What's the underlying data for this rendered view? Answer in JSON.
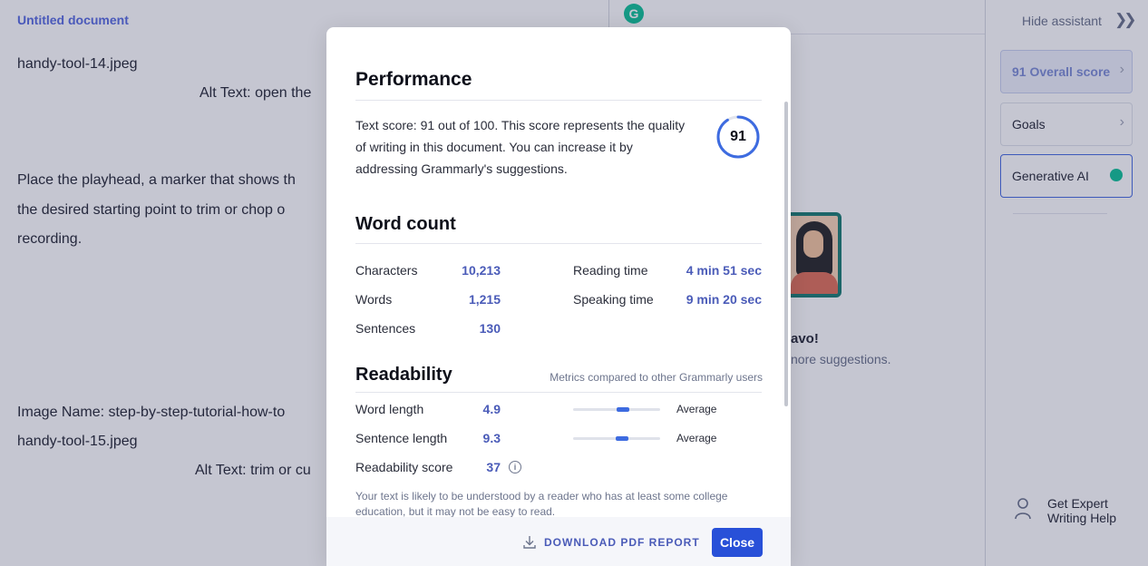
{
  "document": {
    "title": "Untitled document",
    "lines": [
      "handy-tool-14.jpeg",
      "Alt Text: open the",
      "Place the playhead, a marker that shows th",
      "the desired starting point to trim or chop o",
      "recording.",
      "Image Name: step-by-step-tutorial-how-to",
      "handy-tool-15.jpeg",
      "Alt Text: trim or cu"
    ]
  },
  "assistant": {
    "logo_letter": "G",
    "bravo_title": "avo!",
    "bravo_sub": "nore suggestions."
  },
  "sidebar": {
    "hide_label": "Hide assistant",
    "hide_chevrons": "❯❯",
    "overall_score_label": "91 Overall score",
    "goals_label": "Goals",
    "generative_ai_label": "Generative AI",
    "expert_help_line1": "Get Expert",
    "expert_help_line2": "Writing Help"
  },
  "modal": {
    "performance": {
      "heading": "Performance",
      "text": "Text score: 91 out of 100. This score represents the quality of writing in this document. You can increase it by addressing Grammarly's suggestions.",
      "score": "91",
      "score_fraction": 0.91
    },
    "word_count": {
      "heading": "Word count",
      "characters_label": "Characters",
      "characters_value": "10,213",
      "words_label": "Words",
      "words_value": "1,215",
      "sentences_label": "Sentences",
      "sentences_value": "130",
      "reading_time_label": "Reading time",
      "reading_time_value": "4 min 51 sec",
      "speaking_time_label": "Speaking time",
      "speaking_time_value": "9 min 20 sec"
    },
    "readability": {
      "heading": "Readability",
      "note": "Metrics compared to other Grammarly users",
      "word_length_label": "Word length",
      "word_length_value": "4.9",
      "word_length_position": 0.57,
      "word_length_rating": "Average",
      "sentence_length_label": "Sentence length",
      "sentence_length_value": "9.3",
      "sentence_length_position": 0.56,
      "sentence_length_rating": "Average",
      "score_label": "Readability score",
      "score_value": "37",
      "info_glyph": "i",
      "description": "Your text is likely to be understood by a reader who has at least some college education, but it may not be easy to read."
    },
    "footer": {
      "download_label": "DOWNLOAD PDF REPORT",
      "close_label": "Close"
    }
  },
  "colors": {
    "accent": "#2850d8",
    "value_text": "#4a5bb8",
    "grammarly_green": "#15c39a",
    "overlay": "rgba(22, 28, 72, 0.25)"
  },
  "icons": {
    "download": "download-icon",
    "info": "info-icon",
    "expert": "person-icon",
    "bulb": "lightbulb-icon",
    "chevron": "chevron-right-icon"
  }
}
